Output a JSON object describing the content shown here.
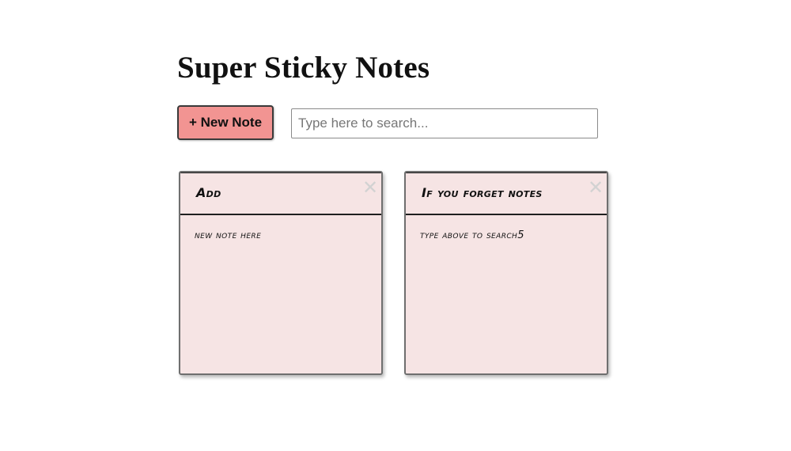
{
  "app": {
    "title": "Super Sticky Notes"
  },
  "toolbar": {
    "new_note_label": "+ New Note",
    "search_placeholder": "Type here to search...",
    "search_value": ""
  },
  "notes": [
    {
      "title": "Add",
      "description": "new note here",
      "close_label": "✕"
    },
    {
      "title": "If you forget notes",
      "description": "type above to search5",
      "close_label": "✕"
    }
  ],
  "colors": {
    "button_background": "#f29492",
    "note_background": "#f6e4e4",
    "close_icon": "#d2d2d2"
  }
}
